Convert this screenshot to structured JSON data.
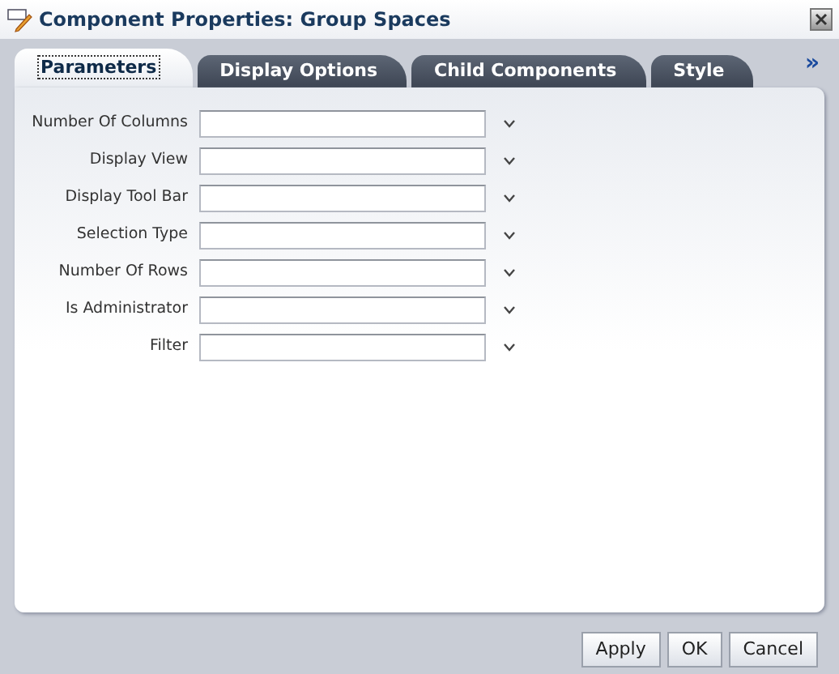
{
  "window": {
    "title": "Component Properties: Group Spaces"
  },
  "tabs": [
    {
      "label": "Parameters",
      "selected": true
    },
    {
      "label": "Display Options",
      "selected": false
    },
    {
      "label": "Child Components",
      "selected": false
    },
    {
      "label": "Style",
      "selected": false
    }
  ],
  "more_tabs": "»",
  "fields": [
    {
      "label": "Number Of Columns"
    },
    {
      "label": "Display View"
    },
    {
      "label": "Display Tool Bar"
    },
    {
      "label": "Selection Type"
    },
    {
      "label": "Number Of Rows"
    },
    {
      "label": "Is Administrator"
    },
    {
      "label": "Filter"
    }
  ],
  "buttons": [
    "Apply",
    "OK",
    "Cancel"
  ]
}
